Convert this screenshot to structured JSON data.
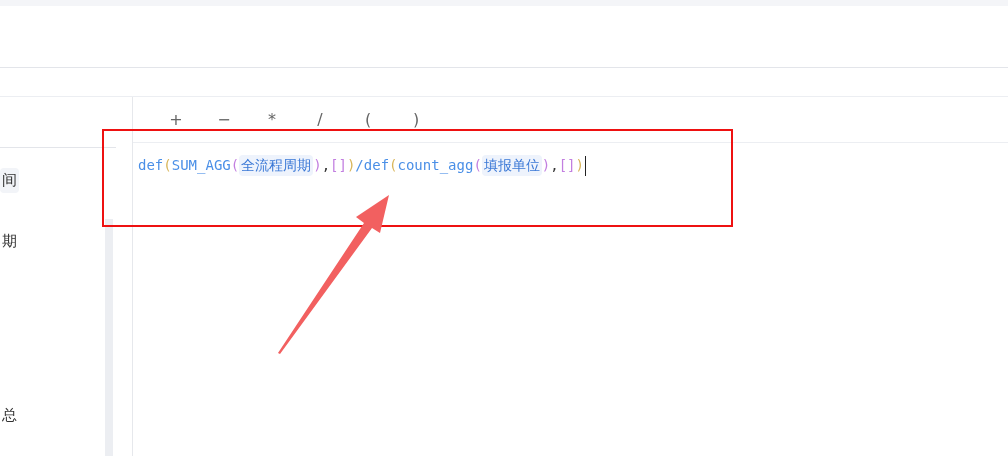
{
  "sidebar": {
    "items": [
      {
        "label": "间",
        "selected": true
      },
      {
        "label": "期",
        "selected": false
      },
      {
        "label": "总",
        "selected": false
      }
    ]
  },
  "operators": [
    "+",
    "−",
    "*",
    "/",
    "(",
    ")"
  ],
  "formula": [
    {
      "kind": "func",
      "text": "def"
    },
    {
      "kind": "paren1",
      "text": "("
    },
    {
      "kind": "func",
      "text": "SUM_AGG"
    },
    {
      "kind": "paren2",
      "text": "("
    },
    {
      "kind": "field",
      "text": "全流程周期"
    },
    {
      "kind": "paren2",
      "text": ")"
    },
    {
      "kind": "punct",
      "text": ","
    },
    {
      "kind": "paren2",
      "text": "[]"
    },
    {
      "kind": "paren1",
      "text": ")"
    },
    {
      "kind": "func",
      "text": "/def"
    },
    {
      "kind": "paren1",
      "text": "("
    },
    {
      "kind": "func",
      "text": "count_agg"
    },
    {
      "kind": "paren2",
      "text": "("
    },
    {
      "kind": "field",
      "text": "填报单位"
    },
    {
      "kind": "paren2",
      "text": ")"
    },
    {
      "kind": "punct",
      "text": ","
    },
    {
      "kind": "paren2",
      "text": "[]"
    },
    {
      "kind": "paren1",
      "text": ")"
    }
  ]
}
